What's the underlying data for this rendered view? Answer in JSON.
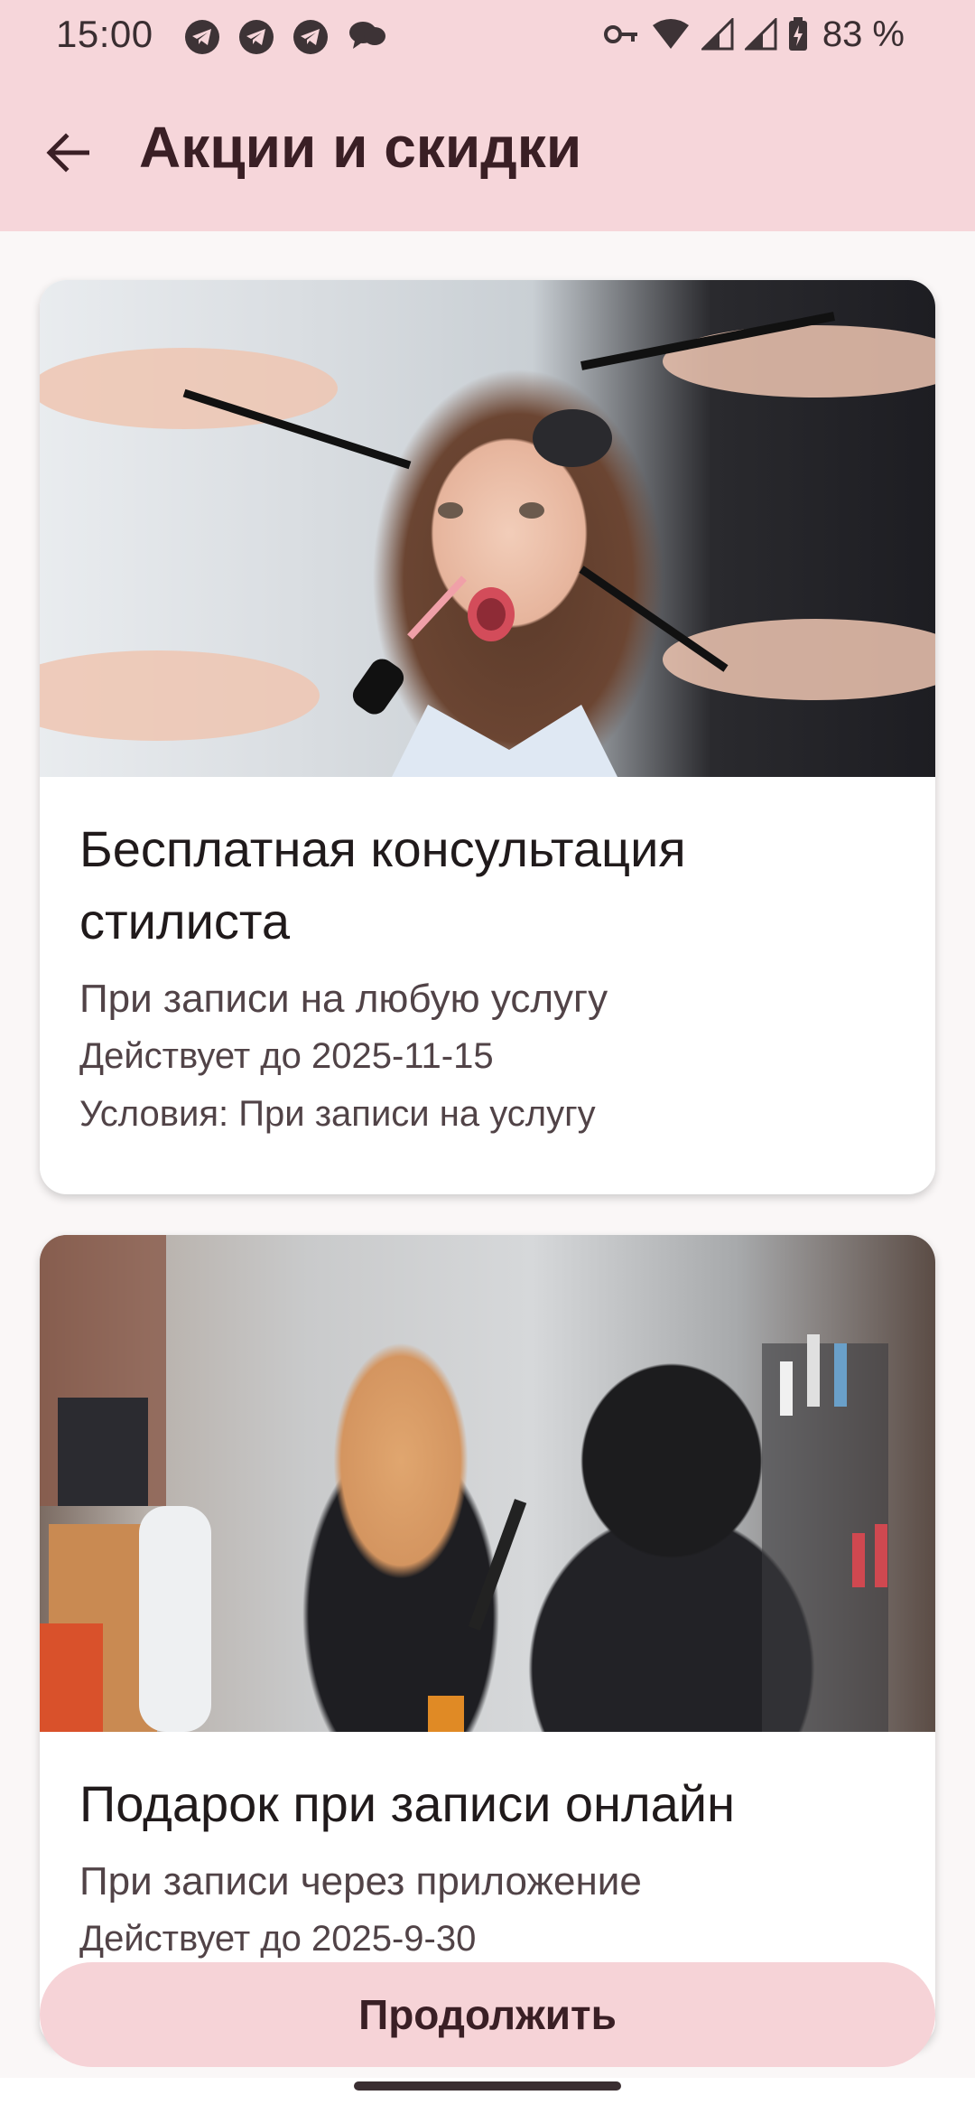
{
  "status_bar": {
    "time": "15:00",
    "notification_icons": [
      "telegram-icon",
      "telegram-icon",
      "telegram-icon",
      "chat-bubbles-icon"
    ],
    "right_icons": [
      "vpn-key-icon",
      "wifi-icon",
      "signal-icon",
      "signal-icon",
      "battery-charging-icon"
    ],
    "battery_percent": "83 %"
  },
  "app_bar": {
    "title": "Акции и скидки",
    "back_icon": "arrow-back-icon"
  },
  "promotions": [
    {
      "image": "photo-salon-makeover",
      "title": "Бесплатная консультация стилиста",
      "description": "При записи на любую услугу",
      "valid_until": "Действует до 2025-11-15",
      "conditions": "Условия: При записи на услугу"
    },
    {
      "image": "photo-hairdresser-styling",
      "title": "Подарок при записи онлайн",
      "description": "При записи через приложение",
      "valid_until": "Действует до 2025-9-30"
    }
  ],
  "continue_button": {
    "label": "Продолжить"
  },
  "colors": {
    "app_bar": "#f6d6da",
    "button": "#f6d3d7",
    "title_text": "#3a1f25",
    "background": "#faf7f7",
    "card": "#ffffff"
  }
}
